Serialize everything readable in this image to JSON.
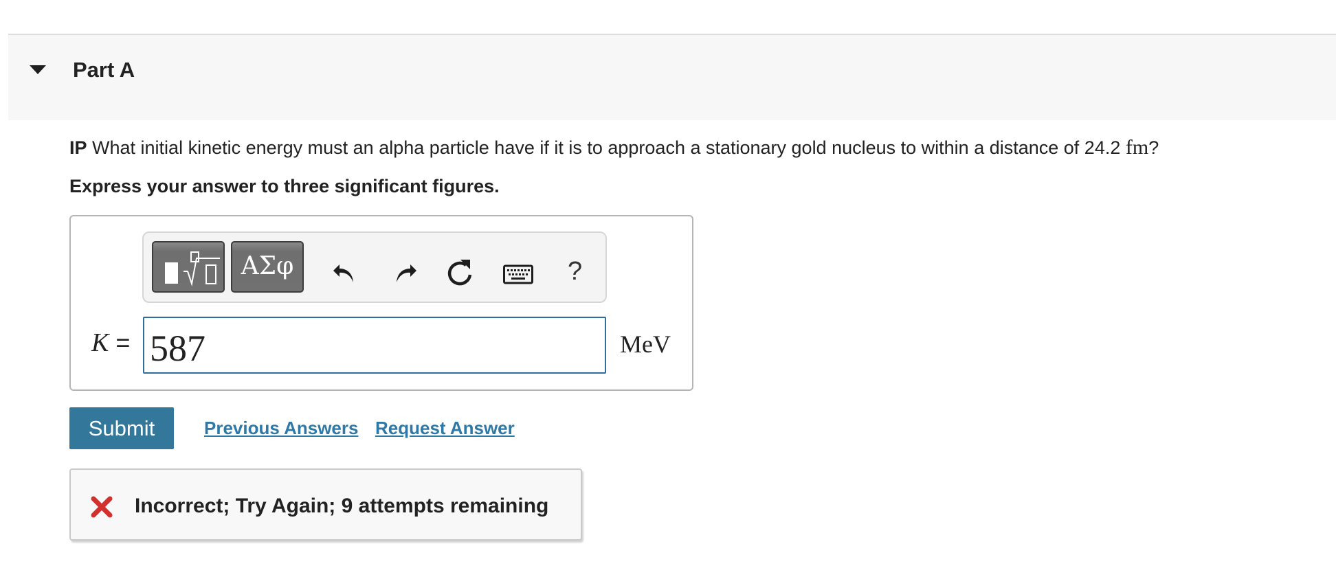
{
  "part": {
    "title": "Part A",
    "toggle_icon": "caret-down-icon"
  },
  "question": {
    "prefix": "IP",
    "text_before_unit": " What initial kinetic energy must an alpha particle have if it is to approach a stationary gold nucleus to within a distance of 24.2 ",
    "unit": "fm",
    "text_after_unit": "?",
    "instruction": "Express your answer to three significant figures."
  },
  "toolbar": {
    "templates_icon": "templates-icon",
    "greek_label": "ΑΣφ",
    "undo_icon": "undo-icon",
    "redo_icon": "redo-icon",
    "reset_icon": "reset-icon",
    "keyboard_icon": "keyboard-icon",
    "help_label": "?"
  },
  "answer": {
    "variable": "K",
    "equals": "=",
    "value": "587",
    "unit": "MeV"
  },
  "actions": {
    "submit_label": "Submit",
    "previous_answers_label": "Previous Answers",
    "request_answer_label": "Request Answer"
  },
  "feedback": {
    "icon": "x-icon",
    "message": "Incorrect; Try Again; 9 attempts remaining",
    "icon_color": "#d0312d"
  },
  "colors": {
    "accent": "#33789b",
    "link": "#2e79a6",
    "input_border": "#2d6e9a"
  }
}
